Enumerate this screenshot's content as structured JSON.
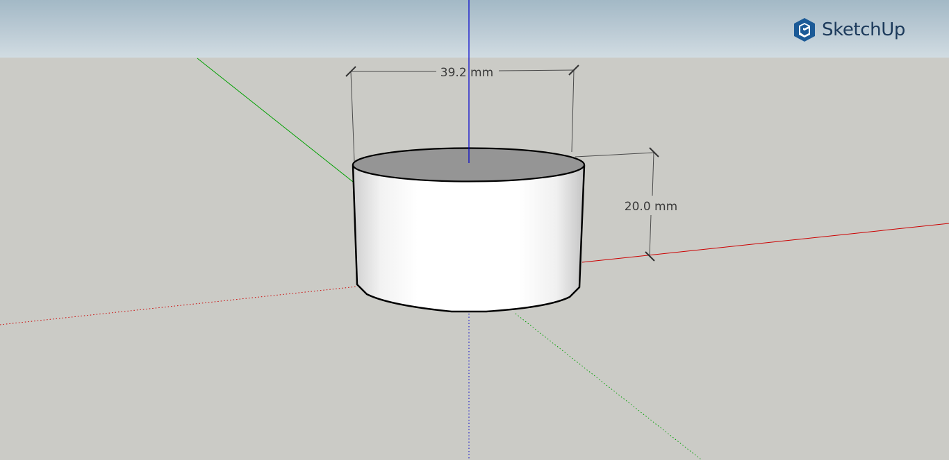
{
  "app": {
    "brand_name": "SketchUp",
    "brand_color": "#1b5a97"
  },
  "viewport": {
    "sky_color": "#bccbd5",
    "ground_color": "#cbcbc6",
    "axes": {
      "x_color": "#cc0000",
      "y_color": "#00a000",
      "z_color": "#0000cc"
    }
  },
  "model": {
    "shape": "cylinder",
    "dimensions": {
      "diameter_label": "39.2 mm",
      "height_label": "20.0 mm"
    }
  }
}
